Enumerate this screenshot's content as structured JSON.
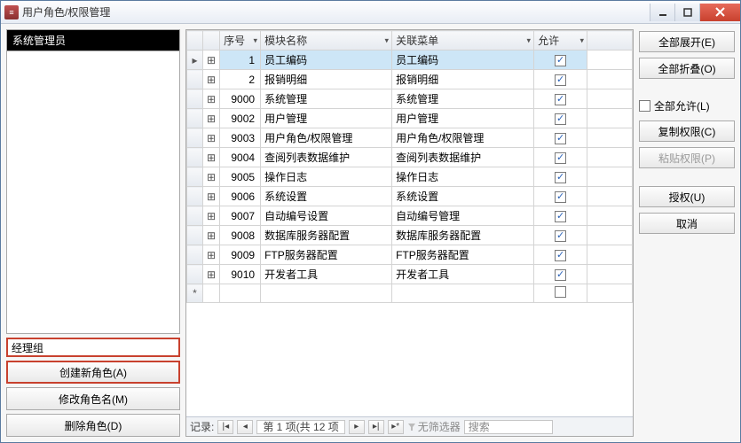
{
  "window": {
    "title": "用户角色/权限管理"
  },
  "roles": {
    "selected": "系统管理员",
    "input_value": "经理组"
  },
  "side_buttons": {
    "create": "创建新角色(A)",
    "rename": "修改角色名(M)",
    "delete": "删除角色(D)"
  },
  "grid": {
    "headers": {
      "seq": "序号",
      "module": "模块名称",
      "menu": "关联菜单",
      "allow": "允许"
    },
    "rows": [
      {
        "seq": "1",
        "module": "员工编码",
        "menu": "员工编码",
        "allow": true,
        "selected": true
      },
      {
        "seq": "2",
        "module": "报销明细",
        "menu": "报销明细",
        "allow": true
      },
      {
        "seq": "9000",
        "module": "系统管理",
        "menu": "系统管理",
        "allow": true
      },
      {
        "seq": "9002",
        "module": "用户管理",
        "menu": "用户管理",
        "allow": true
      },
      {
        "seq": "9003",
        "module": "用户角色/权限管理",
        "menu": "用户角色/权限管理",
        "allow": true
      },
      {
        "seq": "9004",
        "module": "查阅列表数据维护",
        "menu": "查阅列表数据维护",
        "allow": true
      },
      {
        "seq": "9005",
        "module": "操作日志",
        "menu": "操作日志",
        "allow": true
      },
      {
        "seq": "9006",
        "module": "系统设置",
        "menu": "系统设置",
        "allow": true
      },
      {
        "seq": "9007",
        "module": "自动编号设置",
        "menu": "自动编号管理",
        "allow": true
      },
      {
        "seq": "9008",
        "module": "数据库服务器配置",
        "menu": "数据库服务器配置",
        "allow": true
      },
      {
        "seq": "9009",
        "module": "FTP服务器配置",
        "menu": "FTP服务器配置",
        "allow": true
      },
      {
        "seq": "9010",
        "module": "开发者工具",
        "menu": "开发者工具",
        "allow": true
      }
    ]
  },
  "nav": {
    "label": "记录:",
    "counter": "第 1 项(共 12 项",
    "no_filter": "无筛选器",
    "search_placeholder": "搜索"
  },
  "right": {
    "expand_all": "全部展开(E)",
    "collapse_all": "全部折叠(O)",
    "allow_all": "全部允许(L)",
    "copy_perm": "复制权限(C)",
    "paste_perm": "粘贴权限(P)",
    "grant": "授权(U)",
    "cancel": "取消"
  }
}
